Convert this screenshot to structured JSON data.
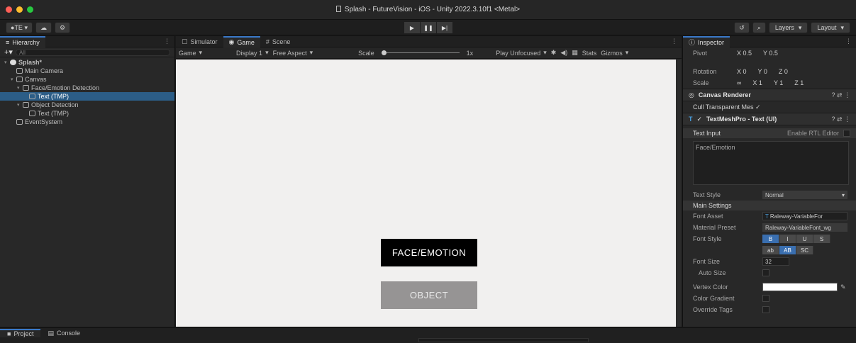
{
  "window": {
    "title": "Splash - FutureVision - iOS - Unity 2022.3.10f1 <Metal>"
  },
  "toolbar": {
    "account_label": "TE ▾",
    "cloud_icon": "cloud-icon",
    "settings_icon": "gear-icon",
    "play_icon": "▶",
    "pause_icon": "❚❚",
    "step_icon": "▶|",
    "history_icon": "history-icon",
    "search_icon": "search-icon",
    "layers_label": "Layers",
    "layout_label": "Layout"
  },
  "hierarchy": {
    "tab_label": "Hierarchy",
    "search_placeholder": "All",
    "items": [
      {
        "label": "Splash*",
        "depth": 0
      },
      {
        "label": "Main Camera",
        "depth": 1
      },
      {
        "label": "Canvas",
        "depth": 1
      },
      {
        "label": "Face/Emotion Detection",
        "depth": 2
      },
      {
        "label": "Text (TMP)",
        "depth": 3,
        "selected": true
      },
      {
        "label": "Object Detection",
        "depth": 2
      },
      {
        "label": "Text (TMP)",
        "depth": 3
      },
      {
        "label": "EventSystem",
        "depth": 1
      }
    ]
  },
  "center": {
    "tabs": [
      "Simulator",
      "Game",
      "Scene"
    ],
    "active_tab": "Game",
    "game_dropdown": "Game",
    "display_dropdown": "Display 1",
    "aspect_dropdown": "Free Aspect",
    "scale_label": "Scale",
    "scale_value": "1x",
    "play_focus": "Play Unfocused",
    "stats_label": "Stats",
    "gizmos_label": "Gizmos",
    "btn_face": "FACE/EMOTION",
    "btn_object": "OBJECT"
  },
  "inspector": {
    "tab_label": "Inspector",
    "pivot": {
      "label": "Pivot",
      "x": "X 0.5",
      "y": "Y 0.5"
    },
    "rotation": {
      "label": "Rotation",
      "x": "X 0",
      "y": "Y 0",
      "z": "Z 0"
    },
    "scale": {
      "label": "Scale",
      "x": "X 1",
      "y": "Y 1",
      "z": "Z 1"
    },
    "canvas_renderer": {
      "title": "Canvas Renderer",
      "cull_label": "Cull Transparent Mes ✓"
    },
    "tmp": {
      "title": "TextMeshPro - Text (UI)",
      "text_input_label": "Text Input",
      "rtl_label": "Enable RTL Editor",
      "text_value": "Face/Emotion",
      "text_style_label": "Text Style",
      "text_style_value": "Normal",
      "main_settings_label": "Main Settings",
      "font_asset_label": "Font Asset",
      "font_asset_value": "Raleway-VariableFor",
      "material_preset_label": "Material Preset",
      "material_preset_value": "Raleway-VariableFont_wg",
      "font_style_label": "Font Style",
      "font_style_row1": [
        "B",
        "I",
        "U",
        "S"
      ],
      "font_style_row2": [
        "ab",
        "AB",
        "SC"
      ],
      "font_size_label": "Font Size",
      "font_size_value": "32",
      "auto_size_label": "Auto Size",
      "vertex_color_label": "Vertex Color",
      "color_gradient_label": "Color Gradient",
      "override_tags_label": "Override Tags"
    }
  },
  "bottom": {
    "tabs": [
      "Project",
      "Console"
    ]
  },
  "colors": {
    "accent": "#3a79c9",
    "selection": "#2c5d87",
    "viewport": "#f1f0ef",
    "button_primary": "#000000",
    "button_secondary": "#969494"
  }
}
